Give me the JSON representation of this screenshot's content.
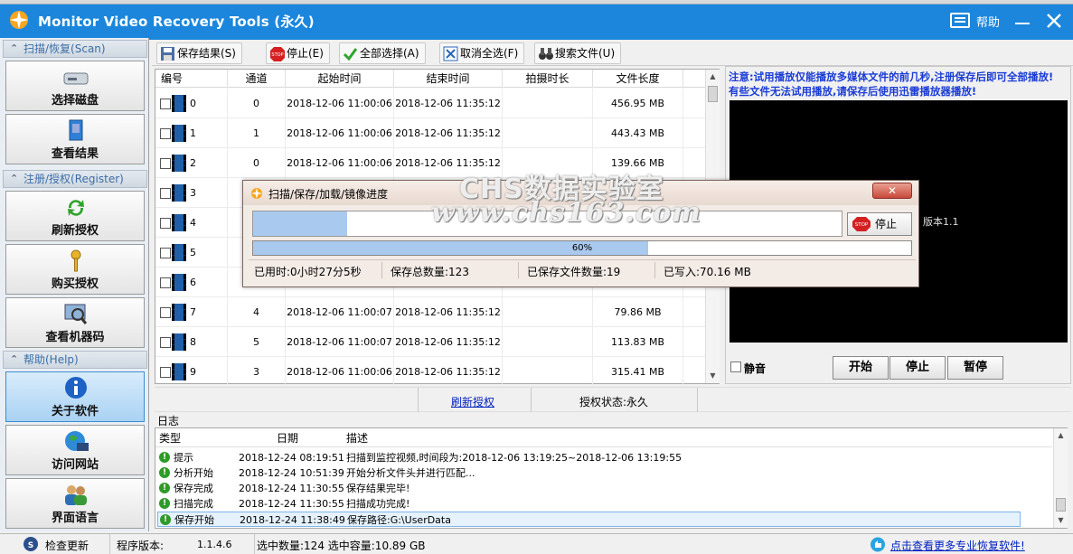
{
  "window": {
    "title": "Monitor Video Recovery Tools (永久)",
    "help_label": "帮助"
  },
  "sidebar": {
    "sections": [
      {
        "header": "扫描/恢复(Scan)",
        "buttons": [
          "选择磁盘",
          "查看结果"
        ]
      },
      {
        "header": "注册/授权(Register)",
        "buttons": [
          "刷新授权",
          "购买授权",
          "查看机器码"
        ]
      },
      {
        "header": "帮助(Help)",
        "buttons": [
          "关于软件",
          "访问网站",
          "界面语言"
        ]
      }
    ]
  },
  "toolbar": {
    "save": "保存结果(S)",
    "stop": "停止(E)",
    "select_all": "全部选择(A)",
    "deselect_all": "取消全选(F)",
    "search": "搜索文件(U)"
  },
  "table": {
    "columns": [
      "编号",
      "通道",
      "起始时间",
      "结束时间",
      "拍摄时长",
      "文件长度"
    ],
    "rows": [
      {
        "id": "0",
        "channel": "0",
        "start": "2018-12-06 11:00:06",
        "end": "2018-12-06 11:35:12",
        "duration": "",
        "size": "456.95 MB"
      },
      {
        "id": "1",
        "channel": "1",
        "start": "2018-12-06 11:00:06",
        "end": "2018-12-06 11:35:12",
        "duration": "",
        "size": "443.43 MB"
      },
      {
        "id": "2",
        "channel": "0",
        "start": "2018-12-06 11:00:06",
        "end": "2018-12-06 11:35:12",
        "duration": "",
        "size": "139.66 MB"
      },
      {
        "id": "3",
        "channel": "",
        "start": "",
        "end": "",
        "duration": "",
        "size": ""
      },
      {
        "id": "4",
        "channel": "",
        "start": "",
        "end": "",
        "duration": "",
        "size": ""
      },
      {
        "id": "5",
        "channel": "",
        "start": "",
        "end": "",
        "duration": "",
        "size": ""
      },
      {
        "id": "6",
        "channel": "",
        "start": "",
        "end": "",
        "duration": "",
        "size": ""
      },
      {
        "id": "7",
        "channel": "4",
        "start": "2018-12-06 11:00:07",
        "end": "2018-12-06 11:35:12",
        "duration": "",
        "size": "79.86 MB"
      },
      {
        "id": "8",
        "channel": "5",
        "start": "2018-12-06 11:00:07",
        "end": "2018-12-06 11:35:12",
        "duration": "",
        "size": "113.83 MB"
      },
      {
        "id": "9",
        "channel": "3",
        "start": "2018-12-06 11:00:06",
        "end": "2018-12-06 11:35:12",
        "duration": "",
        "size": "315.41 MB"
      }
    ]
  },
  "preview": {
    "notice_line1": "注意:试用播放仅能播放多媒体文件的前几秒,注册保存后即可全部播放!",
    "notice_line2": "有些文件无法试用播放,请保存后使用迅雷播放器播放!",
    "player_text": "版本1.1",
    "mute_label": "静音",
    "start_btn": "开始",
    "stop_btn": "停止",
    "pause_btn": "暂停"
  },
  "mid_status": {
    "refresh_link": "刷新授权",
    "license_status": "授权状态:永久"
  },
  "log": {
    "label": "日志",
    "columns": [
      "类型",
      "日期",
      "描述"
    ],
    "rows": [
      {
        "type": "提示",
        "date": "2018-12-24 08:19:51",
        "desc": "扫描到监控视频,时间段为:2018-12-06 13:19:25~2018-12-06 13:19:55"
      },
      {
        "type": "分析开始",
        "date": "2018-12-24 10:51:39",
        "desc": "开始分析文件头并进行匹配..."
      },
      {
        "type": "保存完成",
        "date": "2018-12-24 11:30:55",
        "desc": "保存结果完毕!"
      },
      {
        "type": "扫描完成",
        "date": "2018-12-24 11:30:55",
        "desc": "扫描成功完成!"
      },
      {
        "type": "保存开始",
        "date": "2018-12-24 11:38:49",
        "desc": "保存路径:G:\\UserData"
      }
    ]
  },
  "statusbar": {
    "check_update": "检查更新",
    "version_label": "程序版本:",
    "version": "1.1.4.6",
    "selection": "选中数量:124 选中容量:10.89 GB",
    "more_link": "点击查看更多专业恢复软件!"
  },
  "dialog": {
    "title": "扫描/保存/加载/镜像进度",
    "stop_btn": "停止(E)",
    "file_progress": 0.16,
    "total_progress": 0.6,
    "total_progress_text": "60%",
    "elapsed": "已用时:0小时27分5秒",
    "total_count": "保存总数量:123",
    "saved_count": "已保存文件数量:19",
    "written": "已写入:70.16 MB"
  },
  "watermark": {
    "line1": "CHS数据实验室",
    "line2": "www.chs163.com"
  },
  "colors": {
    "titlebar": "#1b86dc",
    "accent": "#3d8cd1",
    "notice": "#1a3bd6",
    "progress": "#a9c9ee"
  }
}
